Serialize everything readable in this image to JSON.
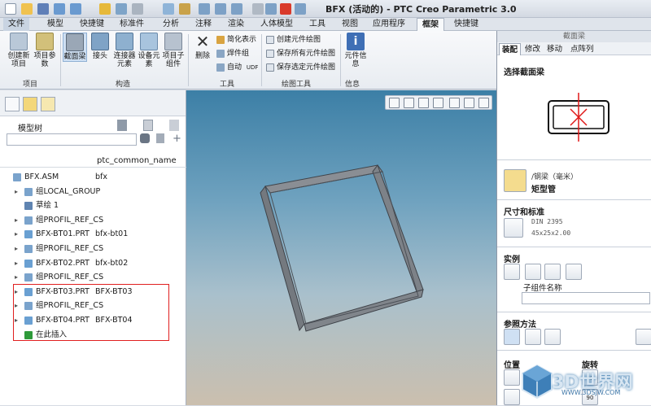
{
  "window_title": "BFX (活动的) - PTC Creo Parametric 3.0",
  "menu_tabs": [
    "文件",
    "模型",
    "快捷键",
    "标准件",
    "分析",
    "注释",
    "渲染",
    "人体模型",
    "工具",
    "视图",
    "应用程序",
    "框架",
    "快捷键"
  ],
  "active_tab": "框架",
  "ribbon": {
    "project_buttons": [
      "创建新项目",
      "项目参数"
    ],
    "build_buttons": [
      "截面梁",
      "接头",
      "连接器元素",
      "设备元素",
      "项目子组件"
    ],
    "tools_big": "删除",
    "tools_small": [
      "简化表示",
      "焊件组",
      "自动"
    ],
    "udf": "UDF",
    "drawing_tools": [
      "创建元件绘图",
      "保存所有元件绘图",
      "保存选定元件绘图"
    ],
    "info_button": "元件信息",
    "groups": [
      "项目",
      "构造",
      "工具",
      "绘图工具",
      "信息"
    ]
  },
  "model_tree": {
    "title": "模型树",
    "column_header": "ptc_common_name",
    "rows": [
      {
        "name": "BFX.ASM",
        "value": "bfx",
        "expand": "",
        "icon": "assembly"
      },
      {
        "name": "组LOCAL_GROUP",
        "value": "",
        "expand": "▸",
        "icon": "group"
      },
      {
        "name": "草绘 1",
        "value": "",
        "expand": "",
        "icon": "sketch"
      },
      {
        "name": "组PROFIL_REF_CS",
        "value": "",
        "expand": "▸",
        "icon": "group"
      },
      {
        "name": "BFX-BT01.PRT",
        "value": "bfx-bt01",
        "expand": "▸",
        "icon": "part"
      },
      {
        "name": "组PROFIL_REF_CS",
        "value": "",
        "expand": "▸",
        "icon": "group"
      },
      {
        "name": "BFX-BT02.PRT",
        "value": "bfx-bt02",
        "expand": "▸",
        "icon": "part"
      },
      {
        "name": "组PROFIL_REF_CS",
        "value": "",
        "expand": "▸",
        "icon": "group"
      },
      {
        "name": "BFX-BT03.PRT",
        "value": "BFX-BT03",
        "expand": "▸",
        "icon": "part"
      },
      {
        "name": "组PROFIL_REF_CS",
        "value": "",
        "expand": "▸",
        "icon": "group"
      },
      {
        "name": "BFX-BT04.PRT",
        "value": "BFX-BT04",
        "expand": "▸",
        "icon": "part"
      },
      {
        "name": "在此插入",
        "value": "",
        "expand": "",
        "icon": "insert"
      }
    ]
  },
  "right_panel": {
    "header": "截面梁",
    "tabs": [
      "装配",
      "修改",
      "移动",
      "点阵列"
    ],
    "active_tab": "装配",
    "select_section": "选择截面梁",
    "profile_path": "/钢梁（毫米）",
    "profile_name": "矩型管",
    "size_standard_label": "尺寸和标准",
    "standard": "DIN 2395",
    "dimension": "45x25x2.00",
    "instance_label": "实例",
    "subcomponent_label": "子组件名称",
    "reference_label": "参照方法",
    "position_label": "位置",
    "rotation_label": "旋转",
    "rotation_values": [
      "90",
      "90"
    ]
  },
  "watermark": {
    "text": "3D世界网",
    "sub": "WWW.3DSJW.COM"
  }
}
